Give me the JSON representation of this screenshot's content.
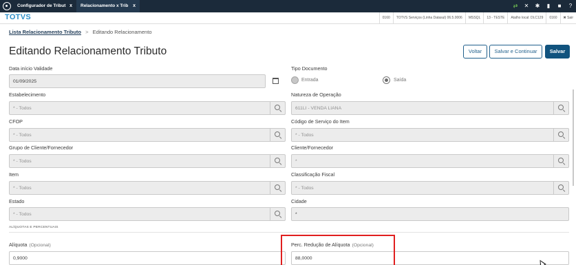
{
  "window": {
    "tabs": [
      {
        "label": "Configurador de Tribut",
        "close": "x"
      },
      {
        "label": "Relacionamento x Trib",
        "close": "x"
      }
    ]
  },
  "header": {
    "logo": "TOTVS",
    "env": [
      "0160",
      "TOTVS Serviços (Linha Datasul) 06.5.0006",
      "MSSQL",
      "13 - TESTE",
      "Atalho local: DLC129",
      "0160",
      "Sair"
    ]
  },
  "breadcrumb": {
    "parent": "Lista Relacionamento Tributo",
    "separator": ">",
    "current": "Editando Relacionamento"
  },
  "page": {
    "title": "Editando Relacionamento Tributo"
  },
  "actions": {
    "voltar": "Voltar",
    "salvar_continuar": "Salvar e Continuar",
    "salvar": "Salvar"
  },
  "form": {
    "data_inicio": {
      "label": "Data início Validade",
      "value": "01/09/2025"
    },
    "tipo_documento": {
      "label": "Tipo Documento",
      "options": [
        "Entrada",
        "Saída"
      ],
      "selected": "Saída"
    },
    "estabelecimento": {
      "label": "Estabelecimento",
      "value": "* - Todos"
    },
    "natureza": {
      "label": "Natureza de Operação",
      "value": "611LI - VENDA LIANA"
    },
    "cfop": {
      "label": "CFOP",
      "value": "* - Todos"
    },
    "codigo_servico": {
      "label": "Código de Serviço do Item",
      "value": "* - Todos"
    },
    "grupo_cliente": {
      "label": "Grupo de Cliente/Fornecedor",
      "value": "* - Todos"
    },
    "cliente": {
      "label": "Cliente/Fornecedor",
      "value": "*"
    },
    "item": {
      "label": "Item",
      "value": "* - Todos"
    },
    "classificacao": {
      "label": "Classificação Fiscal",
      "value": "* - Todos"
    },
    "estado": {
      "label": "Estado",
      "value": "* - Todos"
    },
    "cidade": {
      "label": "Cidade",
      "value": "*"
    },
    "section": "ALÍQUOTAS E PERCENTUAIS",
    "aliquota": {
      "label": "Alíquota",
      "optional": "(Opcional)",
      "value": "0,9000"
    },
    "perc_reducao": {
      "label": "Perc. Redução de Alíquota",
      "optional": "(Opcional)",
      "value": "88,0000"
    }
  },
  "colors": {
    "topbar": "#1b2a3a",
    "primary": "#11537e",
    "logo": "#2e8fc9",
    "highlight": "#e01e1e"
  }
}
